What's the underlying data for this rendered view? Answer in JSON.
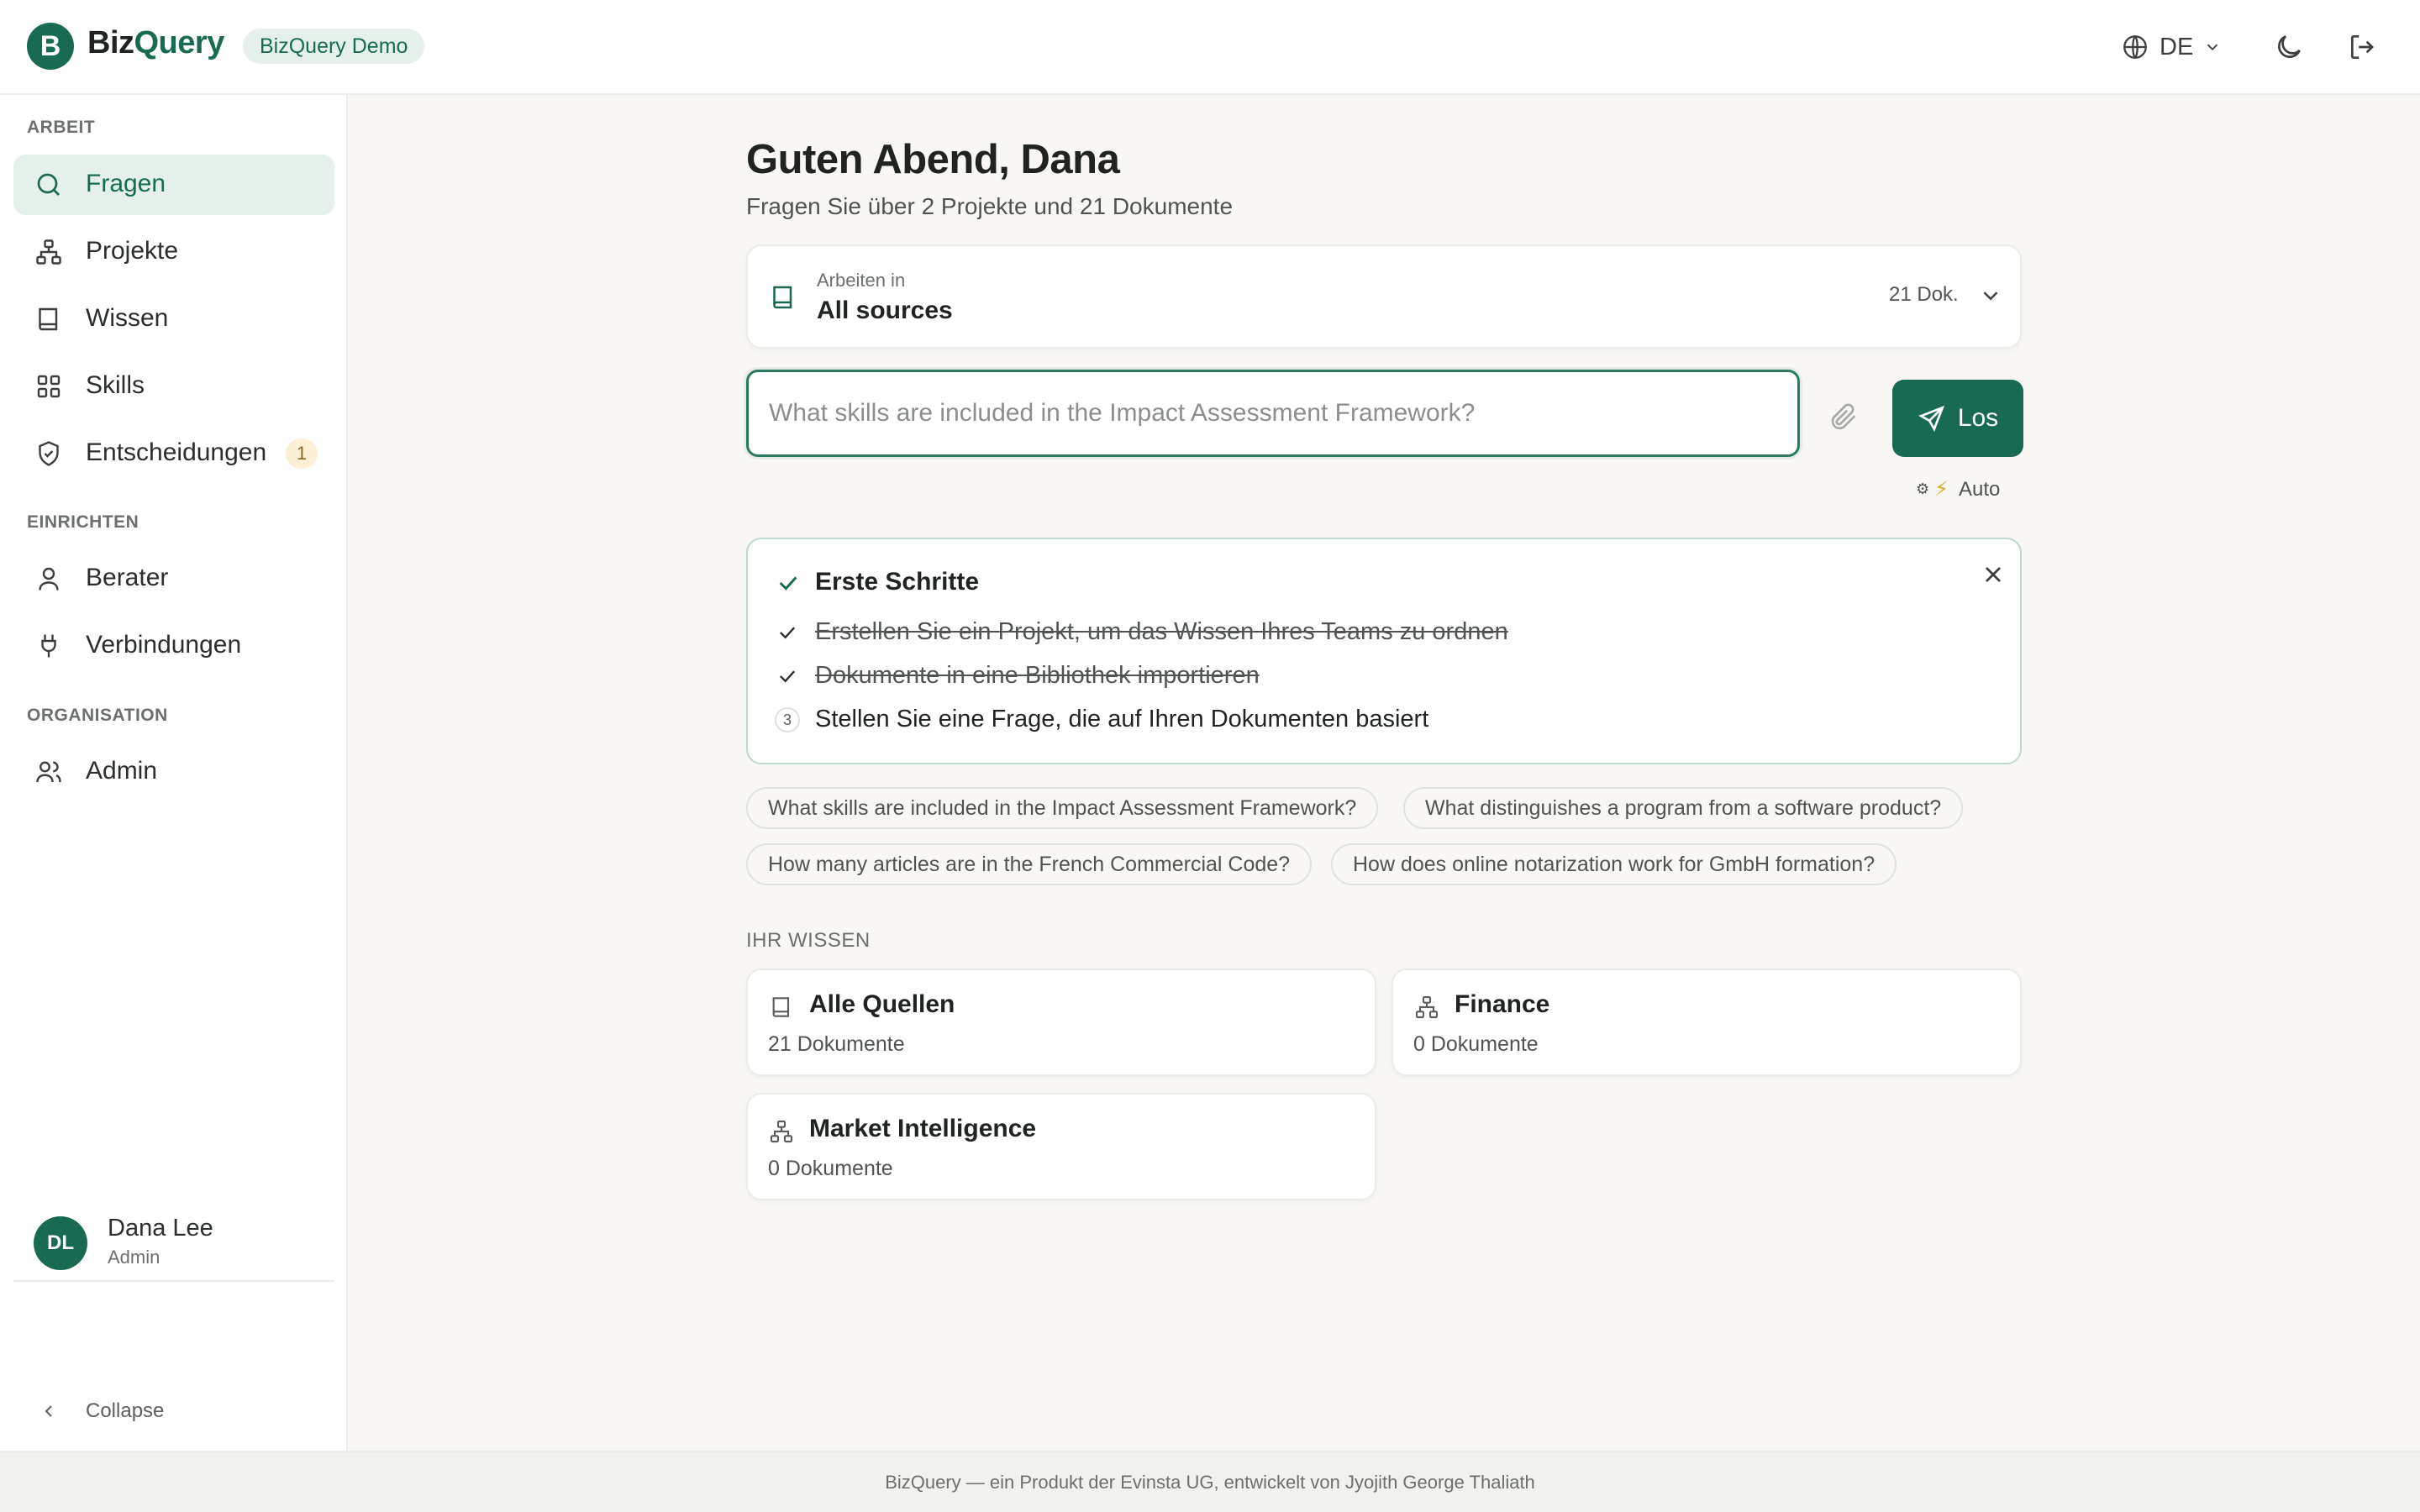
{
  "app": {
    "logo_letter": "B",
    "name_part1": "Biz",
    "name_part2": "Query",
    "badge": "BizQuery Demo"
  },
  "header": {
    "language": "DE",
    "icons": [
      "globe-icon",
      "chevron-down-icon",
      "moon-icon",
      "logout-icon"
    ]
  },
  "sidebar": {
    "sections": [
      {
        "label": "ARBEIT",
        "items": [
          {
            "label": "Fragen",
            "icon": "search-icon",
            "active": true
          },
          {
            "label": "Projekte",
            "icon": "hierarchy-icon"
          },
          {
            "label": "Wissen",
            "icon": "book-icon"
          },
          {
            "label": "Skills",
            "icon": "grid-icon"
          },
          {
            "label": "Entscheidungen",
            "icon": "shield-check-icon",
            "badge": "1"
          }
        ]
      },
      {
        "label": "EINRICHTEN",
        "items": [
          {
            "label": "Berater",
            "icon": "user-icon"
          },
          {
            "label": "Verbindungen",
            "icon": "plug-icon"
          }
        ]
      },
      {
        "label": "ORGANISATION",
        "items": [
          {
            "label": "Admin",
            "icon": "users-icon"
          }
        ]
      }
    ],
    "user": {
      "initials": "DL",
      "name": "Dana Lee",
      "role": "Admin"
    },
    "collapse_label": "Collapse"
  },
  "main": {
    "greeting": "Guten Abend, Dana",
    "subtitle": "Fragen Sie über 2 Projekte und 21 Dokumente",
    "source_selector": {
      "label": "Arbeiten in",
      "value": "All sources",
      "count": "21 Dok."
    },
    "query": {
      "value": "",
      "placeholder": "What skills are included in the Impact Assessment Framework?"
    },
    "send_label": "Los",
    "mode": {
      "prefix": "⚙",
      "bolt": "⚡",
      "label": "Auto"
    },
    "onboarding": {
      "title": "Erste Schritte",
      "steps": [
        {
          "text": "Erstellen Sie ein Projekt, um das Wissen Ihres Teams zu ordnen",
          "done": true
        },
        {
          "text": "Dokumente in eine Bibliothek importieren",
          "done": true
        },
        {
          "number": "3",
          "text": "Stellen Sie eine Frage, die auf Ihren Dokumenten basiert",
          "done": false
        }
      ]
    },
    "suggestions": [
      "What skills are included in the Impact Assessment Framework?",
      "What distinguishes a program from a software product?",
      "How many articles are in the French Commercial Code?",
      "How does online notarization work for GmbH formation?"
    ],
    "knowledge": {
      "label": "IHR WISSEN",
      "cards": [
        {
          "title": "Alle Quellen",
          "count": "21 Dokumente",
          "icon": "book-icon"
        },
        {
          "title": "Finance",
          "count": "0 Dokumente",
          "icon": "hierarchy-icon"
        },
        {
          "title": "Market Intelligence",
          "count": "0 Dokumente",
          "icon": "hierarchy-icon"
        }
      ]
    }
  },
  "footer": {
    "text": "BizQuery — ein Produkt der Evinsta UG, entwickelt von Jyojith George Thaliath"
  },
  "colors": {
    "accent": "#186b52",
    "accent_light": "#e6f0ea",
    "background": "#f8f7f4",
    "badge_warn": "#fbf0d6"
  }
}
